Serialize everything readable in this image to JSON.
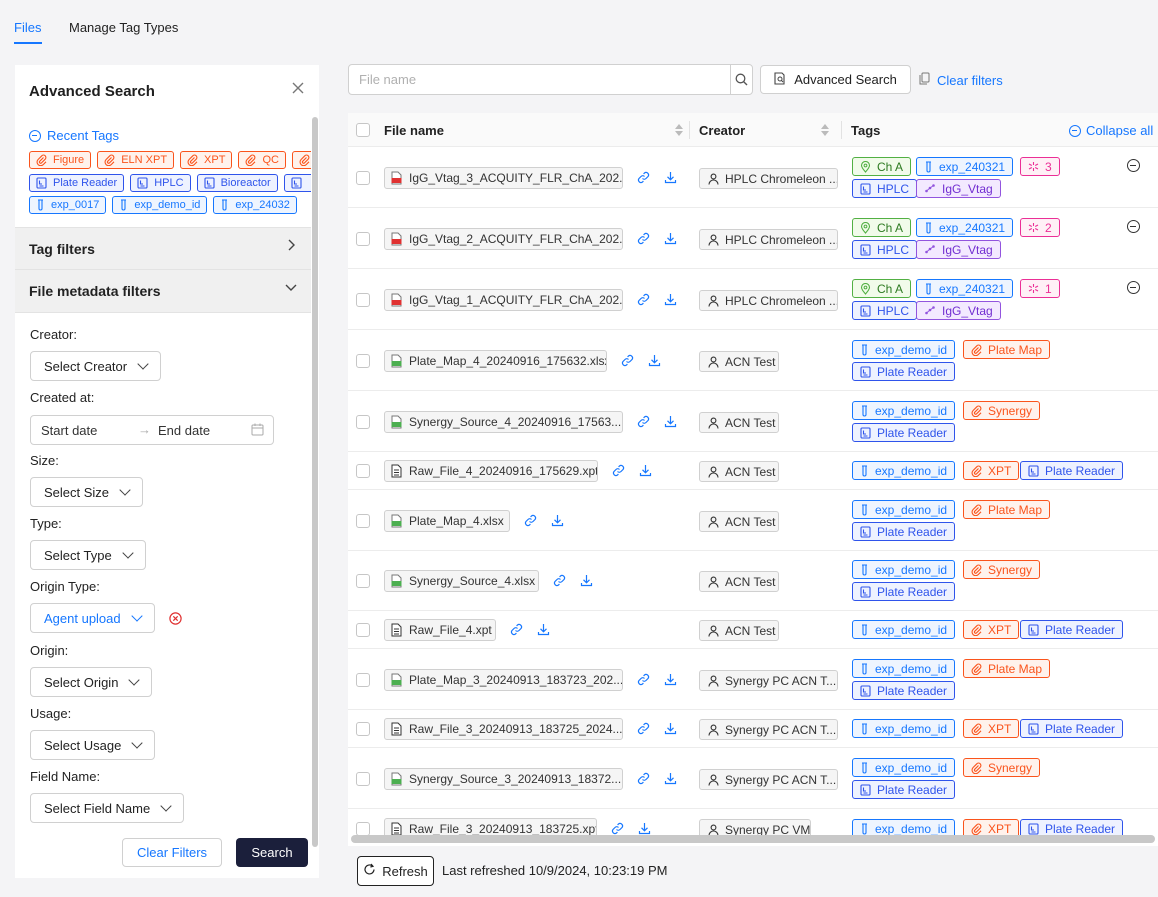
{
  "tabs": [
    {
      "label": "Files",
      "active": true
    },
    {
      "label": "Manage Tag Types",
      "active": false
    }
  ],
  "sidebar": {
    "title": "Advanced Search",
    "recent_tags_label": "Recent Tags",
    "recent_tags": [
      [
        {
          "label": "Figure",
          "color": "orange"
        },
        {
          "label": "ELN XPT",
          "color": "orange"
        },
        {
          "label": "XPT",
          "color": "orange"
        },
        {
          "label": "QC",
          "color": "orange"
        },
        {
          "label": "",
          "color": "orange"
        }
      ],
      [
        {
          "label": "Plate Reader",
          "color": "navy"
        },
        {
          "label": "HPLC",
          "color": "navy"
        },
        {
          "label": "Bioreactor",
          "color": "navy"
        },
        {
          "label": "",
          "color": "navy"
        }
      ],
      [
        {
          "label": "exp_0017",
          "color": "blue"
        },
        {
          "label": "exp_demo_id",
          "color": "blue"
        },
        {
          "label": "exp_24032",
          "color": "blue"
        }
      ]
    ],
    "tag_filters_label": "Tag filters",
    "file_metadata_label": "File metadata filters",
    "filters": {
      "creator_label": "Creator:",
      "creator_value": "Select Creator",
      "created_at_label": "Created at:",
      "start_placeholder": "Start date",
      "end_placeholder": "End date",
      "size_label": "Size:",
      "size_value": "Select Size",
      "type_label": "Type:",
      "type_value": "Select Type",
      "origin_type_label": "Origin Type:",
      "origin_type_value": "Agent upload",
      "origin_label": "Origin:",
      "origin_value": "Select Origin",
      "usage_label": "Usage:",
      "usage_value": "Select Usage",
      "field_name_label": "Field Name:",
      "field_name_value": "Select Field Name"
    },
    "clear_filters_btn": "Clear Filters",
    "search_btn": "Search"
  },
  "toolbar": {
    "search_placeholder": "File name",
    "advanced_search_btn": "Advanced Search",
    "clear_filters_link": "Clear filters"
  },
  "table": {
    "columns": {
      "file_name": "File name",
      "creator": "Creator",
      "tags": "Tags"
    },
    "collapse_all": "Collapse all",
    "rows": [
      {
        "file": "IgG_Vtag_3_ACQUITY_FLR_ChA_202...",
        "file_type": "pdf",
        "creator": "HPLC Chromeleon ...",
        "tags": [
          [
            {
              "label": "Ch A",
              "color": "green",
              "icon": "pin"
            },
            {
              "label": "exp_240321",
              "color": "blue",
              "icon": "flask"
            },
            {
              "label": "3",
              "color": "pink",
              "icon": "spark"
            }
          ],
          [
            {
              "label": "HPLC",
              "color": "navy",
              "icon": "device"
            },
            {
              "label": "IgG_Vtag",
              "color": "purple",
              "icon": "mol"
            }
          ]
        ],
        "collapsible": true
      },
      {
        "file": "IgG_Vtag_2_ACQUITY_FLR_ChA_202...",
        "file_type": "pdf",
        "creator": "HPLC Chromeleon ...",
        "tags": [
          [
            {
              "label": "Ch A",
              "color": "green",
              "icon": "pin"
            },
            {
              "label": "exp_240321",
              "color": "blue",
              "icon": "flask"
            },
            {
              "label": "2",
              "color": "pink",
              "icon": "spark"
            }
          ],
          [
            {
              "label": "HPLC",
              "color": "navy",
              "icon": "device"
            },
            {
              "label": "IgG_Vtag",
              "color": "purple",
              "icon": "mol"
            }
          ]
        ],
        "collapsible": true
      },
      {
        "file": "IgG_Vtag_1_ACQUITY_FLR_ChA_202...",
        "file_type": "pdf",
        "creator": "HPLC Chromeleon ...",
        "tags": [
          [
            {
              "label": "Ch A",
              "color": "green",
              "icon": "pin"
            },
            {
              "label": "exp_240321",
              "color": "blue",
              "icon": "flask"
            },
            {
              "label": "1",
              "color": "pink",
              "icon": "spark"
            }
          ],
          [
            {
              "label": "HPLC",
              "color": "navy",
              "icon": "device"
            },
            {
              "label": "IgG_Vtag",
              "color": "purple",
              "icon": "mol"
            }
          ]
        ],
        "collapsible": true
      },
      {
        "file": "Plate_Map_4_20240916_175632.xlsx",
        "file_type": "xlsx",
        "creator": "ACN Test",
        "tags": [
          [
            {
              "label": "exp_demo_id",
              "color": "blue",
              "icon": "flask"
            },
            {
              "label": "Plate Map",
              "color": "orange",
              "icon": "clip"
            }
          ],
          [
            {
              "label": "Plate Reader",
              "color": "navy",
              "icon": "device"
            }
          ]
        ],
        "collapsible": false
      },
      {
        "file": "Synergy_Source_4_20240916_17563...",
        "file_type": "xlsx",
        "creator": "ACN Test",
        "tags": [
          [
            {
              "label": "exp_demo_id",
              "color": "blue",
              "icon": "flask"
            },
            {
              "label": "Synergy",
              "color": "orange",
              "icon": "clip"
            }
          ],
          [
            {
              "label": "Plate Reader",
              "color": "navy",
              "icon": "device"
            }
          ]
        ],
        "collapsible": false
      },
      {
        "file": "Raw_File_4_20240916_175629.xpt",
        "file_type": "doc",
        "creator": "ACN Test",
        "tags": [
          [
            {
              "label": "exp_demo_id",
              "color": "blue",
              "icon": "flask"
            },
            {
              "label": "XPT",
              "color": "orange",
              "icon": "clip"
            },
            {
              "label": "Plate Reader",
              "color": "navy",
              "icon": "device"
            }
          ]
        ],
        "collapsible": false
      },
      {
        "file": "Plate_Map_4.xlsx",
        "file_type": "xlsx",
        "creator": "ACN Test",
        "tags": [
          [
            {
              "label": "exp_demo_id",
              "color": "blue",
              "icon": "flask"
            },
            {
              "label": "Plate Map",
              "color": "orange",
              "icon": "clip"
            }
          ],
          [
            {
              "label": "Plate Reader",
              "color": "navy",
              "icon": "device"
            }
          ]
        ],
        "collapsible": false
      },
      {
        "file": "Synergy_Source_4.xlsx",
        "file_type": "xlsx",
        "creator": "ACN Test",
        "tags": [
          [
            {
              "label": "exp_demo_id",
              "color": "blue",
              "icon": "flask"
            },
            {
              "label": "Synergy",
              "color": "orange",
              "icon": "clip"
            }
          ],
          [
            {
              "label": "Plate Reader",
              "color": "navy",
              "icon": "device"
            }
          ]
        ],
        "collapsible": false
      },
      {
        "file": "Raw_File_4.xpt",
        "file_type": "doc",
        "creator": "ACN Test",
        "tags": [
          [
            {
              "label": "exp_demo_id",
              "color": "blue",
              "icon": "flask"
            },
            {
              "label": "XPT",
              "color": "orange",
              "icon": "clip"
            },
            {
              "label": "Plate Reader",
              "color": "navy",
              "icon": "device"
            }
          ]
        ],
        "collapsible": false
      },
      {
        "file": "Plate_Map_3_20240913_183723_202...",
        "file_type": "xlsx",
        "creator": "Synergy PC ACN T...",
        "tags": [
          [
            {
              "label": "exp_demo_id",
              "color": "blue",
              "icon": "flask"
            },
            {
              "label": "Plate Map",
              "color": "orange",
              "icon": "clip"
            }
          ],
          [
            {
              "label": "Plate Reader",
              "color": "navy",
              "icon": "device"
            }
          ]
        ],
        "collapsible": false
      },
      {
        "file": "Raw_File_3_20240913_183725_2024...",
        "file_type": "doc",
        "creator": "Synergy PC ACN T...",
        "tags": [
          [
            {
              "label": "exp_demo_id",
              "color": "blue",
              "icon": "flask"
            },
            {
              "label": "XPT",
              "color": "orange",
              "icon": "clip"
            },
            {
              "label": "Plate Reader",
              "color": "navy",
              "icon": "device"
            }
          ]
        ],
        "collapsible": false
      },
      {
        "file": "Synergy_Source_3_20240913_18372...",
        "file_type": "xlsx",
        "creator": "Synergy PC ACN T...",
        "tags": [
          [
            {
              "label": "exp_demo_id",
              "color": "blue",
              "icon": "flask"
            },
            {
              "label": "Synergy",
              "color": "orange",
              "icon": "clip"
            }
          ],
          [
            {
              "label": "Plate Reader",
              "color": "navy",
              "icon": "device"
            }
          ]
        ],
        "collapsible": false
      },
      {
        "file": "Raw_File_3_20240913_183725.xpt",
        "file_type": "doc",
        "creator": "Synergy PC VM",
        "tags": [
          [
            {
              "label": "exp_demo_id",
              "color": "blue",
              "icon": "flask"
            },
            {
              "label": "XPT",
              "color": "orange",
              "icon": "clip"
            },
            {
              "label": "Plate Reader",
              "color": "navy",
              "icon": "device"
            }
          ]
        ],
        "collapsible": false
      }
    ]
  },
  "footer": {
    "refresh_btn": "Refresh",
    "last_refreshed": "Last refreshed 10/9/2024, 10:23:19 PM"
  },
  "colors": {
    "accent": "#1677ff",
    "search_btn_bg": "#1b1f3b",
    "tag_orange": "#fa541c",
    "tag_navy": "#2f54eb",
    "tag_green": "#52b043",
    "tag_pink": "#eb2f96",
    "tag_purple": "#9254de"
  }
}
